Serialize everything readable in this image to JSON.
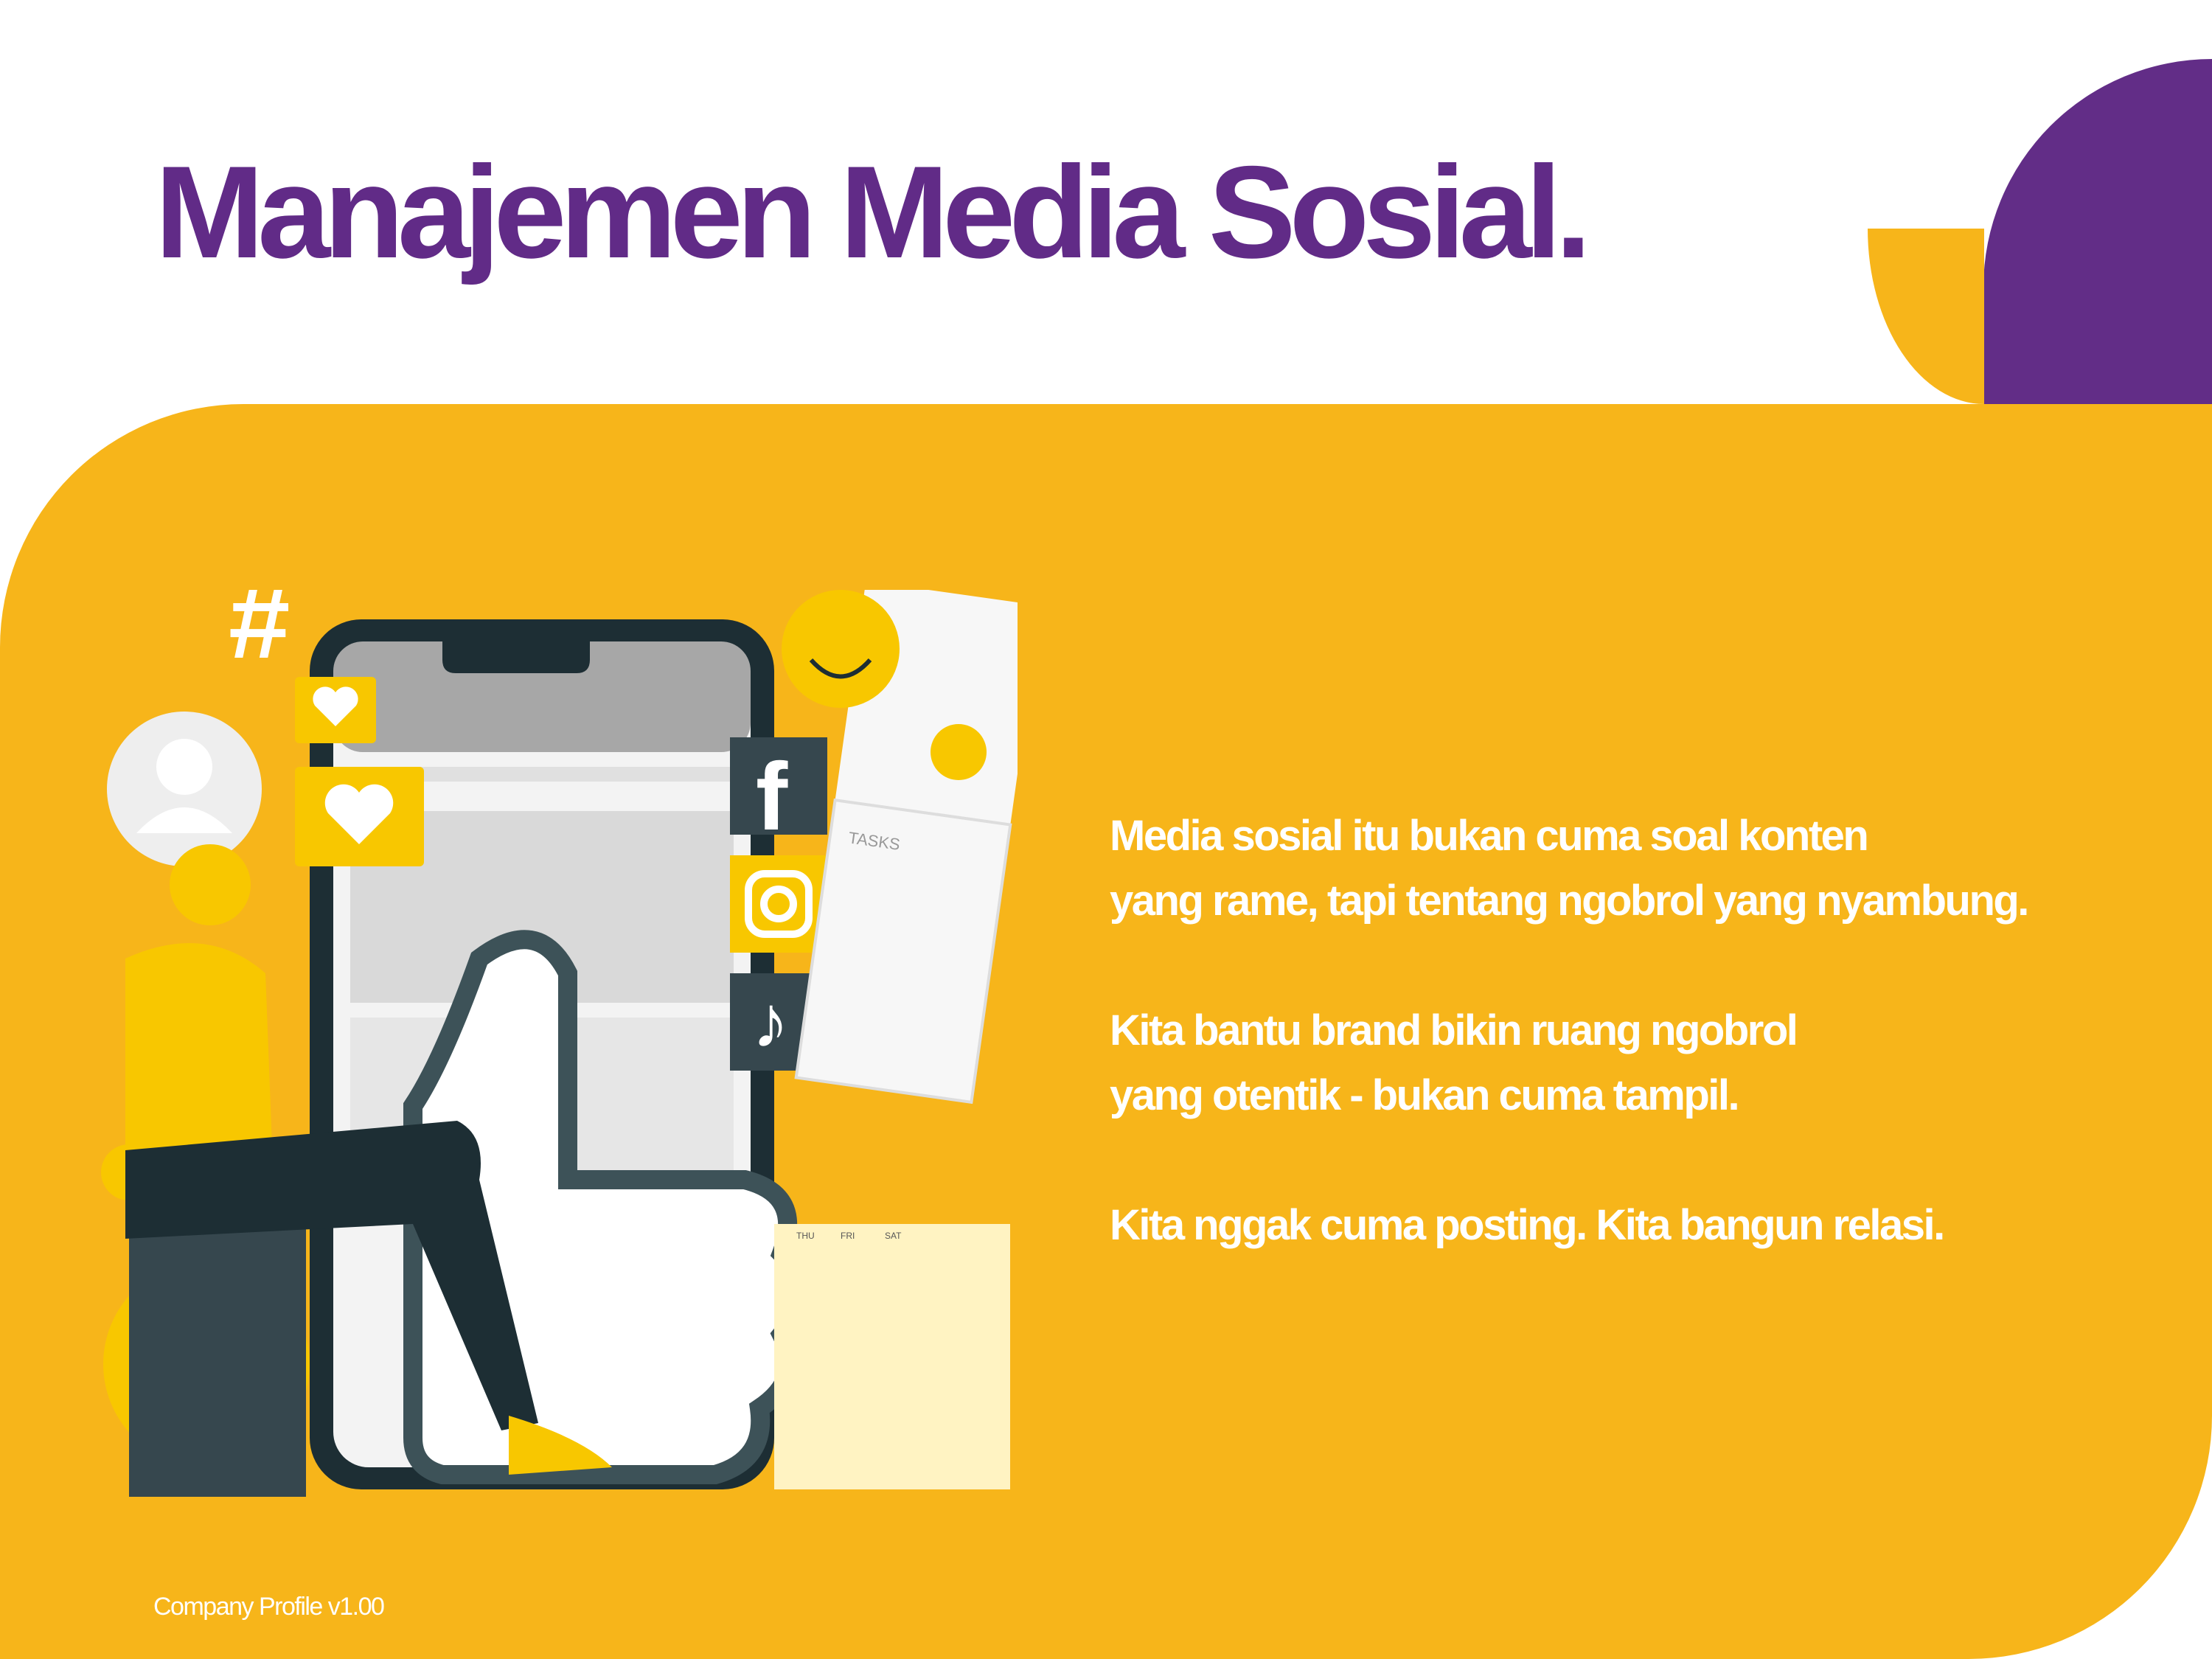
{
  "title": "Manajemen Media Sosial.",
  "paragraphs": [
    "Media sosial itu bukan cuma soal konten\nyang rame, tapi tentang ngobrol yang nyambung.",
    "Kita bantu brand bikin ruang ngobrol\nyang otentik - bukan cuma tampil.",
    "Kita nggak cuma posting. Kita bangun relasi."
  ],
  "footer": "Company Profile v1.00",
  "illustration": {
    "hashtag": "#",
    "card_tasks_label": "TASKS",
    "calendar_days": [
      "THU",
      "FRI",
      "SAT"
    ],
    "social_icons": [
      "facebook-icon",
      "instagram-icon",
      "tiktok-icon"
    ]
  },
  "colors": {
    "purple": "#612b87",
    "yellow": "#f7b51a",
    "white": "#ffffff",
    "dark": "#1d2e34"
  }
}
